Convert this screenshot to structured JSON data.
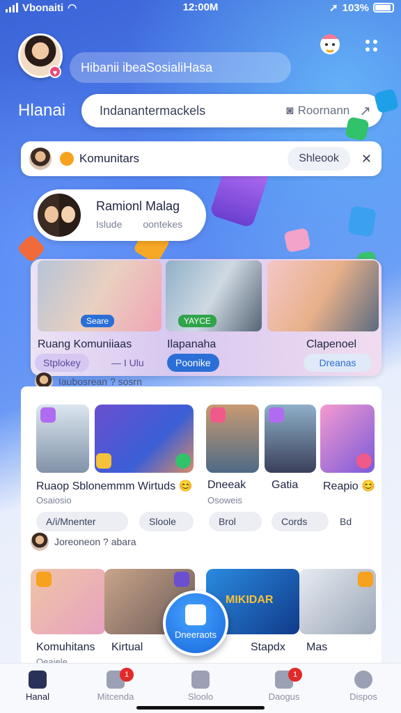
{
  "status": {
    "carrier": "Vbonaiti",
    "time": "12:00M",
    "battery": "103%"
  },
  "header": {
    "greeting": "Hibanii ibeaSosialiHasa"
  },
  "page": {
    "title": "Hlanai"
  },
  "search": {
    "value": "Indanantermackels",
    "filter_label": "Roornann"
  },
  "community_bar": {
    "label": "Komunitars",
    "pill": "Shleook"
  },
  "profile_card": {
    "name": "Ramionl Malag",
    "sub1": "Islude",
    "sub2": "oontekes"
  },
  "featured": {
    "items": [
      {
        "title": "Ruang Komuniiaas",
        "badge": "Seare",
        "chip": "Stplokey",
        "chip2": "— I Ulu"
      },
      {
        "title": "Ilapanaha",
        "badge": "YAYCE",
        "chip": "Poonike"
      },
      {
        "title": "Clapenoel",
        "chip": "Dreanas"
      }
    ]
  },
  "section1": {
    "header": "Iaubosrean ? sosrn",
    "items": [
      {
        "title": "Ruaop Sblonemmm Wirtuds 😊",
        "sub": "Osaiosio"
      },
      {
        "title": "Dneeak",
        "sub": "Osoweis"
      },
      {
        "title": "Gatia",
        "sub": ""
      },
      {
        "title": "Reapio 😊",
        "sub": ""
      }
    ],
    "buttons": [
      "A/i/Mnenter",
      "Sloole",
      "Brol",
      "Cords",
      "Bd"
    ]
  },
  "section2": {
    "header": "Joreoneon ? abara",
    "items": [
      {
        "title": "Komuhitans",
        "sub": "Oeaiele"
      },
      {
        "title": "Kirtual",
        "sub": ""
      },
      {
        "title": "Stapdx",
        "sub": ""
      },
      {
        "title": "Mas",
        "sub": ""
      }
    ],
    "poster_text": "MIKIDAR"
  },
  "fab": {
    "label": "Dneeraots"
  },
  "tabs": [
    {
      "label": "Hanal",
      "badge": ""
    },
    {
      "label": "Mitcenda",
      "badge": "1"
    },
    {
      "label": "Sloolo",
      "badge": ""
    },
    {
      "label": "Daogus",
      "badge": "1"
    },
    {
      "label": "Dispos",
      "badge": ""
    }
  ],
  "colors": {
    "accent": "#1868dc",
    "brand_gradient_top": "#3a63d6",
    "badge": "#e12a2a"
  }
}
